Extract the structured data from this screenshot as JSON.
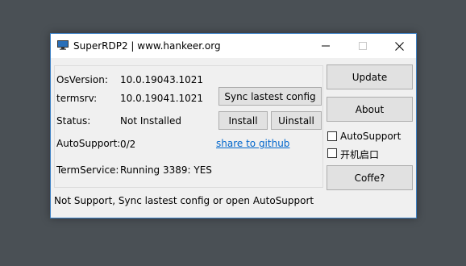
{
  "window": {
    "title": "SuperRDP2 | www.hankeer.org"
  },
  "info": {
    "os_version_label": "OsVersion:",
    "os_version_value": "10.0.19043.1021",
    "termsrv_label": "termsrv:",
    "termsrv_value": "10.0.19041.1021",
    "status_label": "Status:",
    "status_value": "Not Installed",
    "autosupport_label": "AutoSupport:",
    "autosupport_value": "0/2",
    "termservice_label": "TermService:",
    "termservice_value": "Running 3389: YES"
  },
  "buttons": {
    "sync": "Sync lastest config",
    "install": "Install",
    "uninstall": "Uinstall",
    "update": "Update",
    "about": "About",
    "coffe": "Coffe?"
  },
  "links": {
    "share": "share to github"
  },
  "checkboxes": {
    "autosupport": {
      "label": "AutoSupport",
      "checked": false
    },
    "startup": {
      "label": "开机启口",
      "checked": false
    }
  },
  "statusbar": {
    "text": "Not Support, Sync lastest config or open AutoSupport"
  },
  "colors": {
    "desktop": "#4a5055",
    "window_border": "#3b7fc4",
    "link": "#0066cc"
  }
}
